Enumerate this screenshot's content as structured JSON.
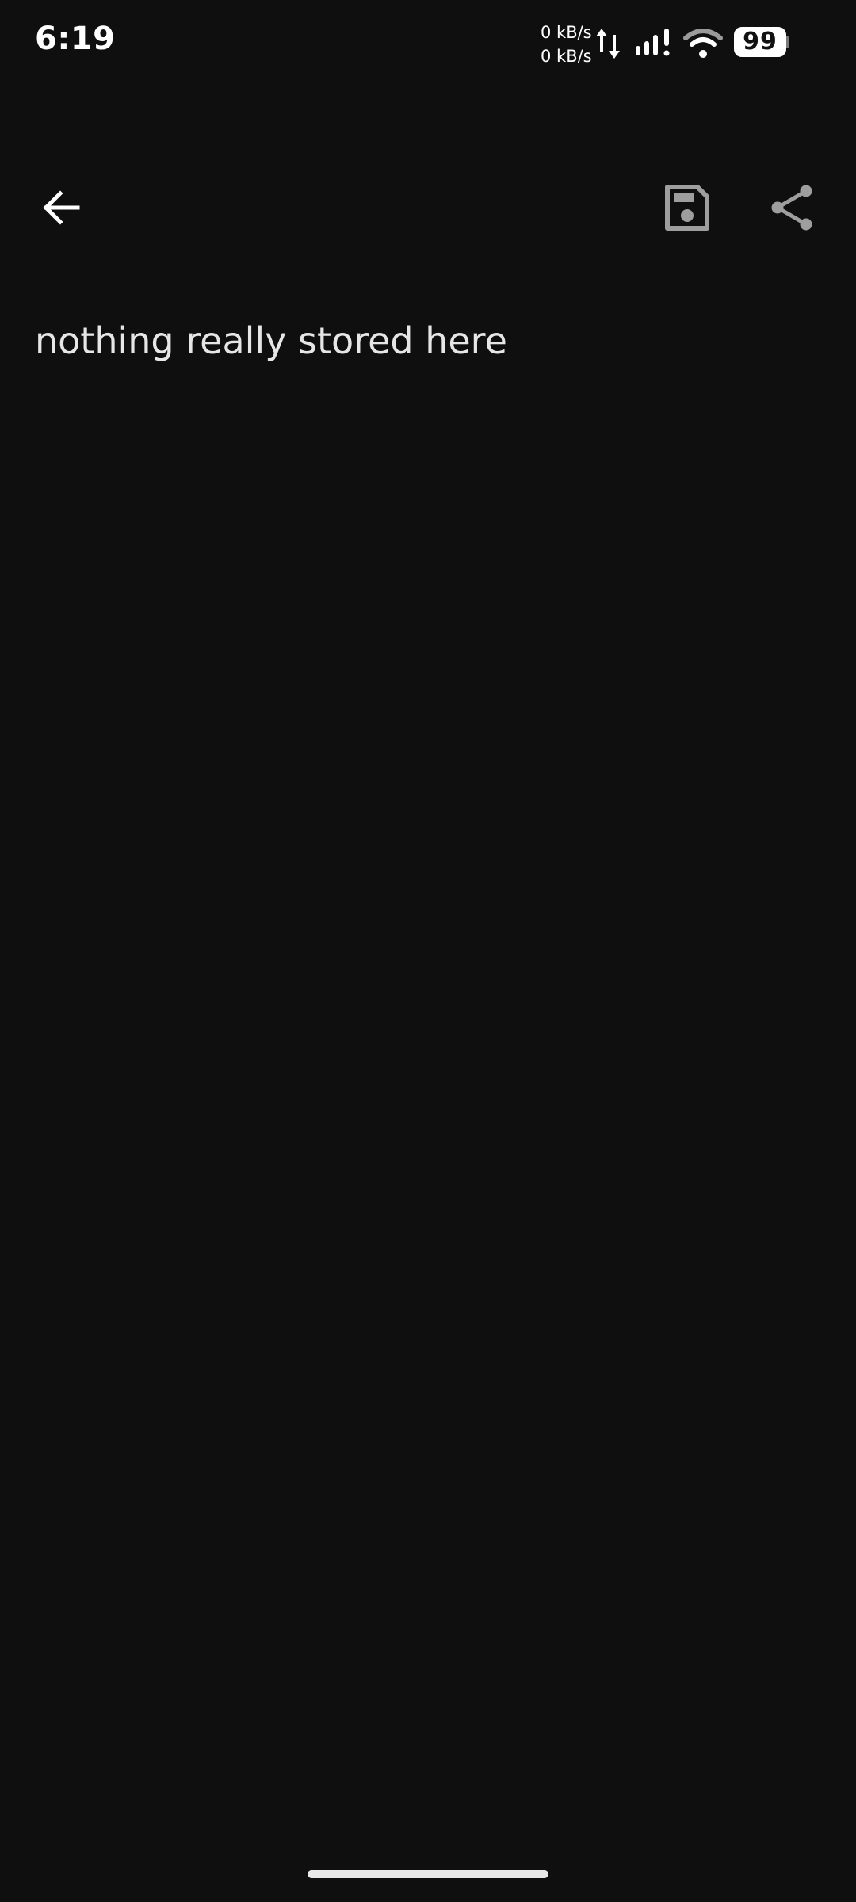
{
  "status_bar": {
    "time": "6:19",
    "upload_speed": "0 kB/s",
    "download_speed": "0 kB/s",
    "battery_level": "99",
    "icons": [
      "data-arrows-icon",
      "signal-icon",
      "wifi-icon",
      "battery-icon"
    ]
  },
  "toolbar": {
    "back_icon": "arrow-left-icon",
    "save_icon": "floppy-disk-icon",
    "share_icon": "share-icon"
  },
  "note": {
    "content": "nothing really stored here"
  },
  "colors": {
    "background": "#0f0f0f",
    "text": "#e6e6e6",
    "icon_active": "#ffffff",
    "icon_muted": "#9e9e9e"
  }
}
